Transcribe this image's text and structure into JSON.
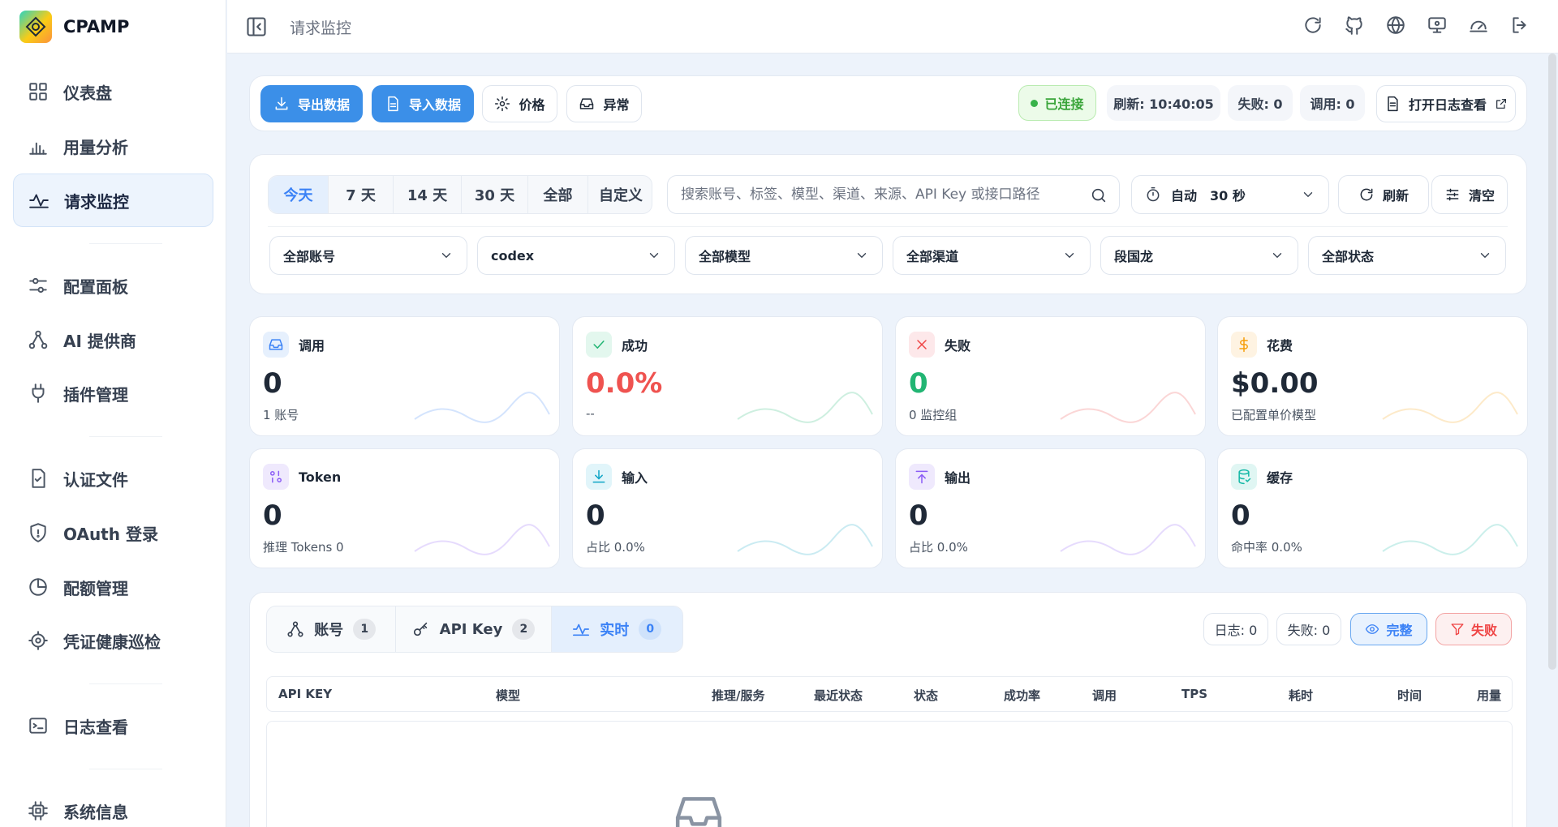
{
  "app": {
    "name": "CPAMP"
  },
  "sidebar": {
    "items": [
      {
        "label": "仪表盘",
        "icon": "dashboard-icon"
      },
      {
        "label": "用量分析",
        "icon": "bar-chart-icon"
      },
      {
        "label": "请求监控",
        "icon": "activity-icon",
        "active": true
      },
      {
        "label": "配置面板",
        "icon": "sliders-icon"
      },
      {
        "label": "AI 提供商",
        "icon": "network-icon"
      },
      {
        "label": "插件管理",
        "icon": "plug-icon"
      },
      {
        "label": "认证文件",
        "icon": "file-check-icon"
      },
      {
        "label": "OAuth 登录",
        "icon": "shield-icon"
      },
      {
        "label": "配额管理",
        "icon": "pie-clock-icon"
      },
      {
        "label": "凭证健康巡检",
        "icon": "target-icon"
      },
      {
        "label": "日志查看",
        "icon": "terminal-icon"
      },
      {
        "label": "系统信息",
        "icon": "cpu-icon"
      }
    ]
  },
  "topbar": {
    "title": "请求监控",
    "icons": [
      "refresh-icon",
      "github-icon",
      "globe-icon",
      "monitor-icon",
      "gauge-icon",
      "logout-icon"
    ]
  },
  "toolbar": {
    "export_label": "导出数据",
    "import_label": "导入数据",
    "price_label": "价格",
    "anomaly_label": "异常",
    "connected_label": "已连接",
    "refresh_time": "刷新: 10:40:05",
    "fail_count": "失败: 0",
    "call_count": "调用: 0",
    "open_log_label": "打开日志查看"
  },
  "filters": {
    "ranges": [
      "今天",
      "7 天",
      "14 天",
      "30 天",
      "全部",
      "自定义"
    ],
    "search_placeholder": "搜索账号、标签、模型、渠道、来源、API Key 或接口路径",
    "auto_label": "自动",
    "interval": "30 秒",
    "refresh_label": "刷新",
    "clear_label": "清空",
    "selects": [
      "全部账号",
      "codex",
      "全部模型",
      "全部渠道",
      "段国龙",
      "全部状态"
    ]
  },
  "stats": [
    {
      "title": "调用",
      "value": "0",
      "sub": "1 账号",
      "icon": "inbox-icon",
      "color": "#3b82f6",
      "bg": "#e6f0fd"
    },
    {
      "title": "成功",
      "value": "0.0%",
      "sub": "--",
      "icon": "check-icon",
      "color": "#22b573",
      "bg": "#e3f7ee",
      "value_color": "#ef5350"
    },
    {
      "title": "失败",
      "value": "0",
      "sub": "0 监控组",
      "icon": "x-icon",
      "color": "#ef4444",
      "bg": "#fde8ea",
      "value_color": "#22b573"
    },
    {
      "title": "花费",
      "value": "$0.00",
      "sub": "已配置单价模型",
      "icon": "dollar-icon",
      "color": "#f59e0b",
      "bg": "#fef3e2"
    },
    {
      "title": "Token",
      "value": "0",
      "sub": "推理 Tokens 0",
      "icon": "token-icon",
      "color": "#8b5cf6",
      "bg": "#efe9fd"
    },
    {
      "title": "输入",
      "value": "0",
      "sub": "占比 0.0%",
      "icon": "download-icon",
      "color": "#0ea5c6",
      "bg": "#e1f5fa"
    },
    {
      "title": "输出",
      "value": "0",
      "sub": "占比 0.0%",
      "icon": "upload-icon",
      "color": "#8b5cf6",
      "bg": "#efe9fd"
    },
    {
      "title": "缓存",
      "value": "0",
      "sub": "命中率 0.0%",
      "icon": "database-icon",
      "color": "#14b8a6",
      "bg": "#e0f6f3"
    }
  ],
  "panel": {
    "tabs": [
      {
        "label": "账号",
        "count": "1",
        "icon": "network-icon"
      },
      {
        "label": "API Key",
        "count": "2",
        "icon": "key-icon"
      },
      {
        "label": "实时",
        "count": "0",
        "icon": "activity-icon",
        "active": true
      }
    ],
    "log_count": "日志: 0",
    "fail_count": "失败: 0",
    "full_label": "完整",
    "fail_filter_label": "失败",
    "columns": [
      "API KEY",
      "模型",
      "推理/服务",
      "最近状态",
      "状态",
      "成功率",
      "调用",
      "TPS",
      "耗时",
      "时间",
      "用量"
    ]
  }
}
